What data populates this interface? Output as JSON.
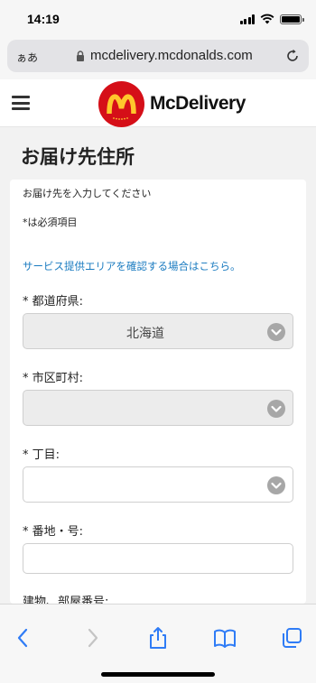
{
  "status_bar": {
    "time": "14:19"
  },
  "browser": {
    "text_size_label": "ぁあ",
    "url": "mcdelivery.mcdonalds.com"
  },
  "header": {
    "brand": "McDelivery",
    "brand_color": "#d50f18",
    "logo_color": "#ffc72c"
  },
  "page": {
    "title": "お届け先住所",
    "instruction": "お届け先を入力してください",
    "required_note": "*は必須項目",
    "service_area_link": "サービス提供エリアを確認する場合はこちら。"
  },
  "form": {
    "prefecture_label": "* 都道府県:",
    "prefecture_value": "北海道",
    "city_label": "* 市区町村:",
    "city_value": "",
    "chome_label": "* 丁目:",
    "chome_value": "",
    "banchi_label": "* 番地・号:",
    "banchi_value": "",
    "building_label": "建物、部屋番号:"
  },
  "colors": {
    "link": "#1a7bc0",
    "accent_blue": "#2f7cf6"
  }
}
